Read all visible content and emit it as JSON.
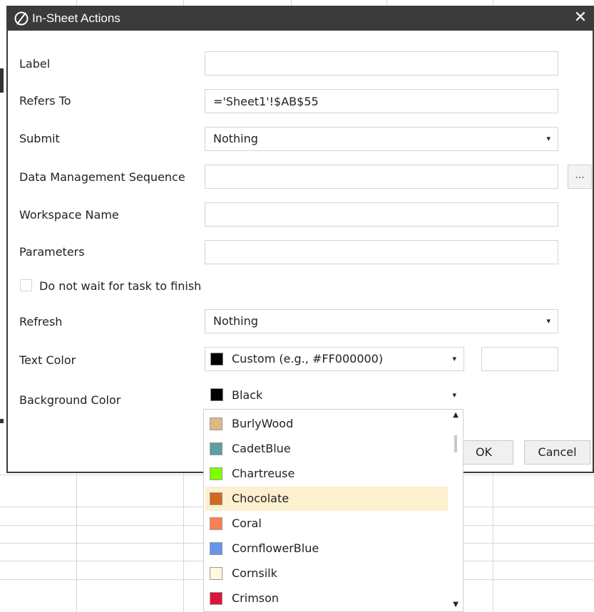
{
  "dialog": {
    "title": "In-Sheet Actions",
    "close_glyph": "✕"
  },
  "form": {
    "label": {
      "label": "Label",
      "value": ""
    },
    "refers_to": {
      "label": "Refers To",
      "value": "='Sheet1'!$AB$55"
    },
    "submit": {
      "label": "Submit",
      "value": "Nothing"
    },
    "dms": {
      "label": "Data Management Sequence",
      "value": "",
      "button": "..."
    },
    "workspace": {
      "label": "Workspace Name",
      "value": ""
    },
    "parameters": {
      "label": "Parameters",
      "value": ""
    },
    "no_wait": {
      "label": "Do not wait for task to finish",
      "checked": false
    },
    "refresh": {
      "label": "Refresh",
      "value": "Nothing"
    },
    "text_color": {
      "label": "Text Color",
      "value": "Custom (e.g., #FF000000)",
      "swatch": "#000000",
      "hex_value": ""
    },
    "background_color": {
      "label": "Background Color",
      "value": "Black",
      "swatch": "#000000"
    }
  },
  "buttons": {
    "ok": "OK",
    "cancel": "Cancel"
  },
  "caret_glyph": "▾",
  "color_options": [
    {
      "name": "BurlyWood",
      "color": "#DEB887",
      "highlighted": false
    },
    {
      "name": "CadetBlue",
      "color": "#5F9EA0",
      "highlighted": false
    },
    {
      "name": "Chartreuse",
      "color": "#7FFF00",
      "highlighted": false
    },
    {
      "name": "Chocolate",
      "color": "#D2691E",
      "highlighted": true
    },
    {
      "name": "Coral",
      "color": "#FF7F50",
      "highlighted": false
    },
    {
      "name": "CornflowerBlue",
      "color": "#6495ED",
      "highlighted": false
    },
    {
      "name": "Cornsilk",
      "color": "#FFF8DC",
      "highlighted": false
    },
    {
      "name": "Crimson",
      "color": "#DC143C",
      "highlighted": false
    }
  ],
  "colors": {
    "titlebar": "#3b3b3b",
    "highlight": "#fdf0cf",
    "grid": "#d7d7d7"
  }
}
